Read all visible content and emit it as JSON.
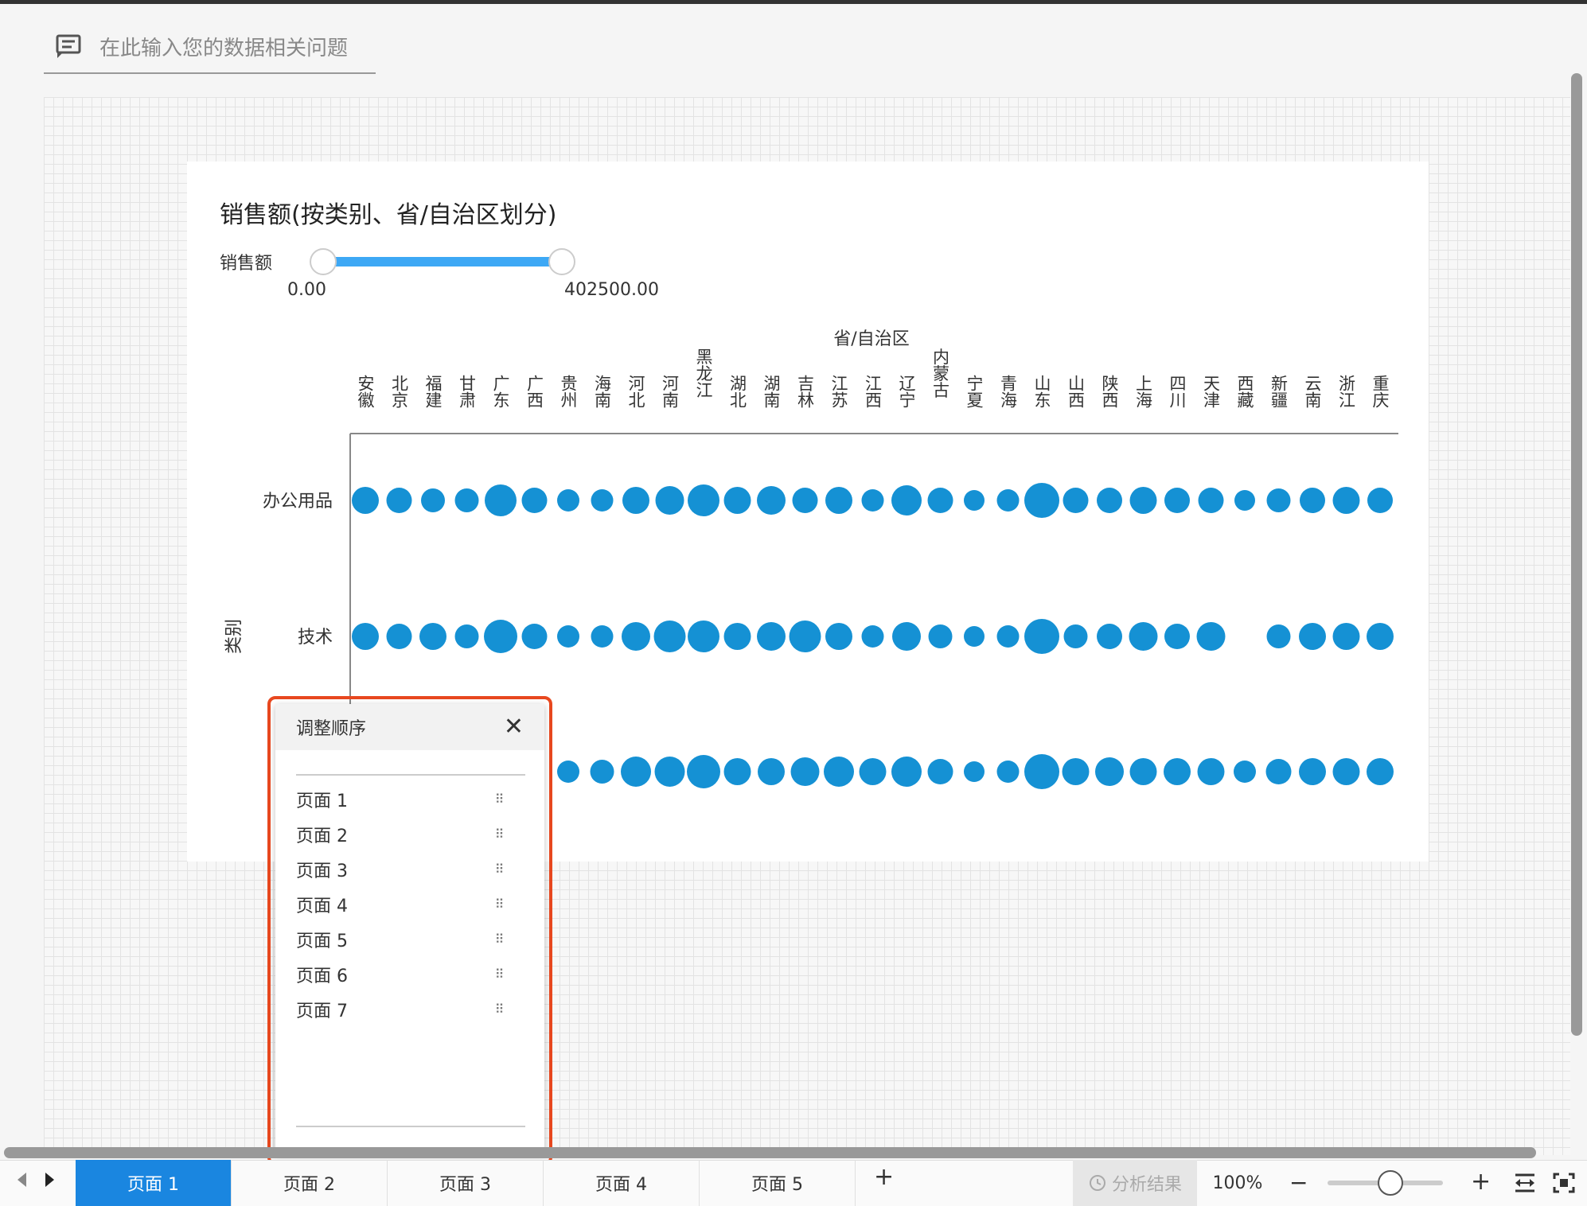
{
  "query": {
    "placeholder": "在此输入您的数据相关问题",
    "icon": "comment-icon"
  },
  "chart_data": {
    "type": "scatter",
    "title": "销售额(按类别、省/自治区划分)",
    "filter": {
      "label": "销售额",
      "min": "0.00",
      "max": "402500.00"
    },
    "x_axis_title": "省/自治区",
    "y_axis_title": "类别",
    "provinces": [
      "安徽",
      "北京",
      "福建",
      "甘肃",
      "广东",
      "广西",
      "贵州",
      "海南",
      "河北",
      "河南",
      "黑龙江",
      "湖北",
      "湖南",
      "吉林",
      "江苏",
      "江西",
      "辽宁",
      "内蒙古",
      "宁夏",
      "青海",
      "山东",
      "山西",
      "陕西",
      "上海",
      "四川",
      "天津",
      "西藏",
      "新疆",
      "云南",
      "浙江",
      "重庆"
    ],
    "categories": [
      "办公用品",
      "技术",
      ""
    ],
    "series": [
      {
        "values": [
          13,
          12,
          11,
          11,
          16,
          12,
          10,
          10,
          13,
          14,
          16,
          13,
          14,
          12,
          13,
          10,
          15,
          12,
          9,
          10,
          18,
          12,
          12,
          13,
          12,
          12,
          9,
          11,
          12,
          13,
          12
        ]
      },
      {
        "values": [
          13,
          12,
          13,
          11,
          17,
          12,
          10,
          10,
          14,
          16,
          16,
          13,
          14,
          16,
          13,
          10,
          14,
          11,
          9,
          10,
          18,
          11,
          12,
          14,
          12,
          14,
          null,
          11,
          13,
          13,
          13
        ]
      },
      {
        "values": [
          null,
          null,
          null,
          null,
          null,
          null,
          10,
          11,
          15,
          15,
          17,
          13,
          13,
          14,
          15,
          13,
          15,
          12,
          9,
          10,
          18,
          13,
          14,
          13,
          13,
          13,
          10,
          12,
          13,
          13,
          13
        ]
      }
    ]
  },
  "popup": {
    "title": "调整顺序",
    "close_icon": "close-icon",
    "items": [
      "页面 1",
      "页面 2",
      "页面 3",
      "页面 4",
      "页面 5",
      "页面 6",
      "页面 7"
    ]
  },
  "tabs": [
    "页面 1",
    "页面 2",
    "页面 3",
    "页面 4",
    "页面 5"
  ],
  "add_tab": "+",
  "analysis_button": "分析结果",
  "zoom": {
    "percent": "100%",
    "minus": "−",
    "plus": "+",
    "level": 0.5
  },
  "colors": {
    "accent": "#1a86e0",
    "dot": "#1591d4",
    "highlight": "#e8481f"
  }
}
